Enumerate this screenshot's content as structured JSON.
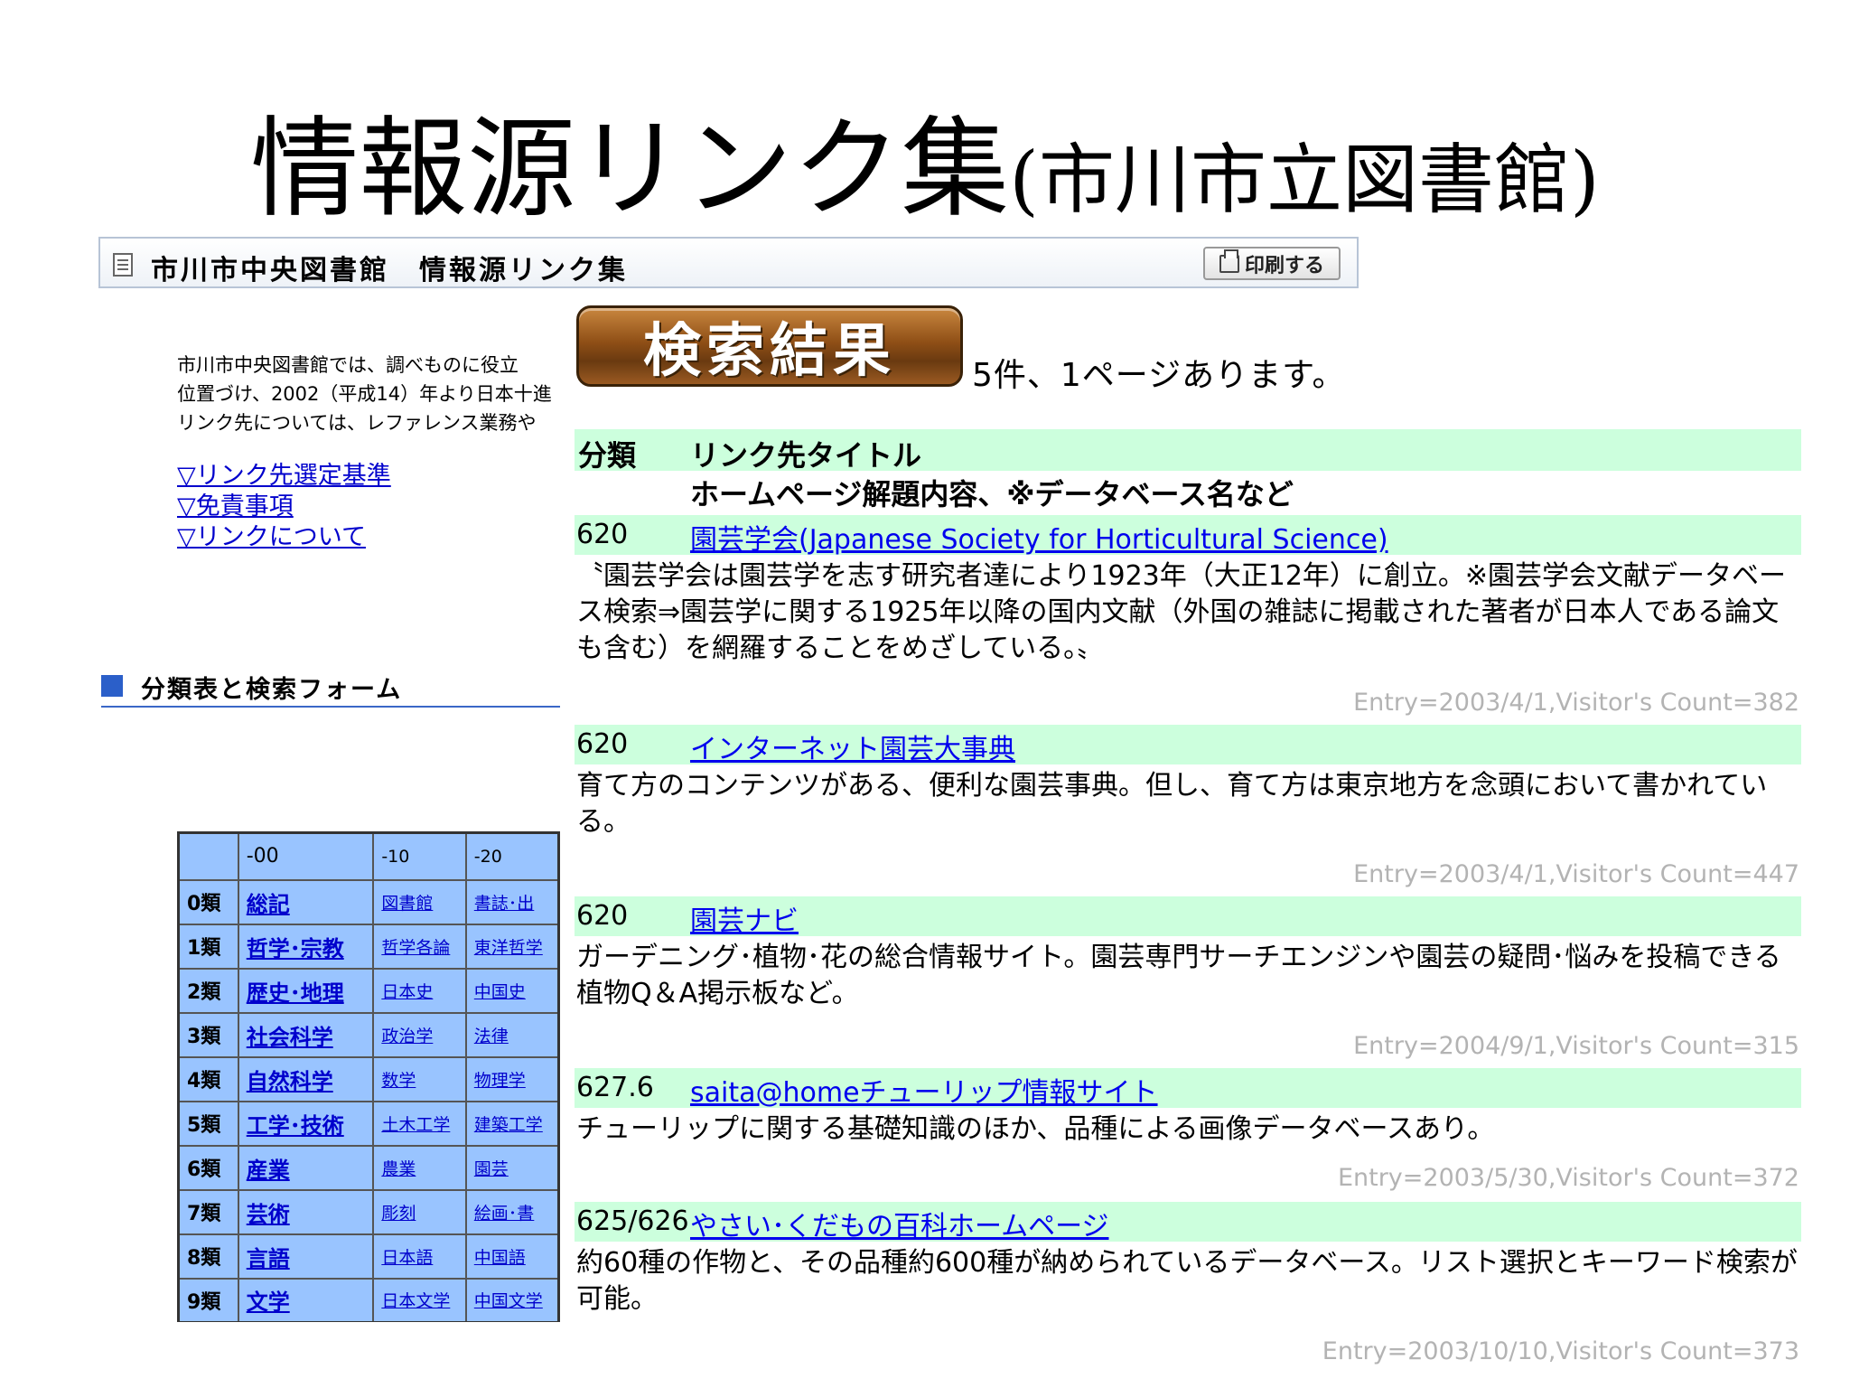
{
  "slide": {
    "title_main": "情報源リンク集",
    "title_sub": "(市川市立図書館)"
  },
  "page": {
    "header_title": "市川市中央図書館　情報源リンク集",
    "print_label": "印刷する",
    "intro_lines": [
      "市川市中央図書館では、調べものに役立",
      "位置づけ、2002（平成14）年より日本十進",
      "リンク先については、レファレンス業務や"
    ],
    "links": [
      "▽リンク先選定基準",
      "▽免責事項",
      "▽リンクについて"
    ],
    "section_label": "分類表と検索フォーム",
    "ndc_header": [
      "-00",
      "-10",
      "-20"
    ],
    "ndc_rows": [
      {
        "cls": "0類",
        "main": "総記",
        "sub": "図書館",
        "sub2": "書誌･出"
      },
      {
        "cls": "1類",
        "main": "哲学･宗教",
        "sub": "哲学各論",
        "sub2": "東洋哲学"
      },
      {
        "cls": "2類",
        "main": "歴史･地理",
        "sub": "日本史",
        "sub2": "中国史"
      },
      {
        "cls": "3類",
        "main": "社会科学",
        "sub": "政治学",
        "sub2": "法律"
      },
      {
        "cls": "4類",
        "main": "自然科学",
        "sub": "数学",
        "sub2": "物理学"
      },
      {
        "cls": "5類",
        "main": "工学･技術",
        "sub": "土木工学",
        "sub2": "建築工学"
      },
      {
        "cls": "6類",
        "main": "産業",
        "sub": "農業",
        "sub2": "園芸"
      },
      {
        "cls": "7類",
        "main": "芸術",
        "sub": "彫刻",
        "sub2": "絵画･書"
      },
      {
        "cls": "8類",
        "main": "言語",
        "sub": "日本語",
        "sub2": "中国語"
      },
      {
        "cls": "9類",
        "main": "文学",
        "sub": "日本文学",
        "sub2": "中国文学"
      }
    ]
  },
  "results": {
    "banner": "検索結果",
    "count_text": "5件、1ページあります。",
    "col_class": "分類",
    "col_title": "リンク先タイトル",
    "col_desc": "ホームページ解題内容、※データベース名など",
    "entries": [
      {
        "code": "620",
        "title": "園芸学会(Japanese Society for Horticultural Science)",
        "desc": "〝園芸学会は園芸学を志す研究者達により1923年（大正12年）に創立。※園芸学会文献データベース検索⇒園芸学に関する1925年以降の国内文献（外国の雑誌に掲載された著者が日本人である論文も含む）を網羅することをめざしている。〟",
        "meta": "Entry=2003/4/1,Visitor's Count=382"
      },
      {
        "code": "620",
        "title": "インターネット園芸大事典",
        "desc": "育て方のコンテンツがある、便利な園芸事典。但し、育て方は東京地方を念頭において書かれている。",
        "meta": "Entry=2003/4/1,Visitor's Count=447"
      },
      {
        "code": "620",
        "title": "園芸ナビ",
        "desc": "ガーデニング･植物･花の総合情報サイト。園芸専門サーチエンジンや園芸の疑問･悩みを投稿できる植物Q＆A掲示板など。",
        "meta": "Entry=2004/9/1,Visitor's Count=315"
      },
      {
        "code": "627.6",
        "title": "saita@homeチューリップ情報サイト",
        "desc": "チューリップに関する基礎知識のほか、品種による画像データベースあり。",
        "meta": "Entry=2003/5/30,Visitor's Count=372"
      },
      {
        "code": "625/626",
        "title": "やさい･くだもの百科ホームページ",
        "desc": "約60種の作物と、その品種約600種が納められているデータベース。リスト選択とキーワード検索が可能。",
        "meta": "Entry=2003/10/10,Visitor's Count=373"
      }
    ]
  }
}
